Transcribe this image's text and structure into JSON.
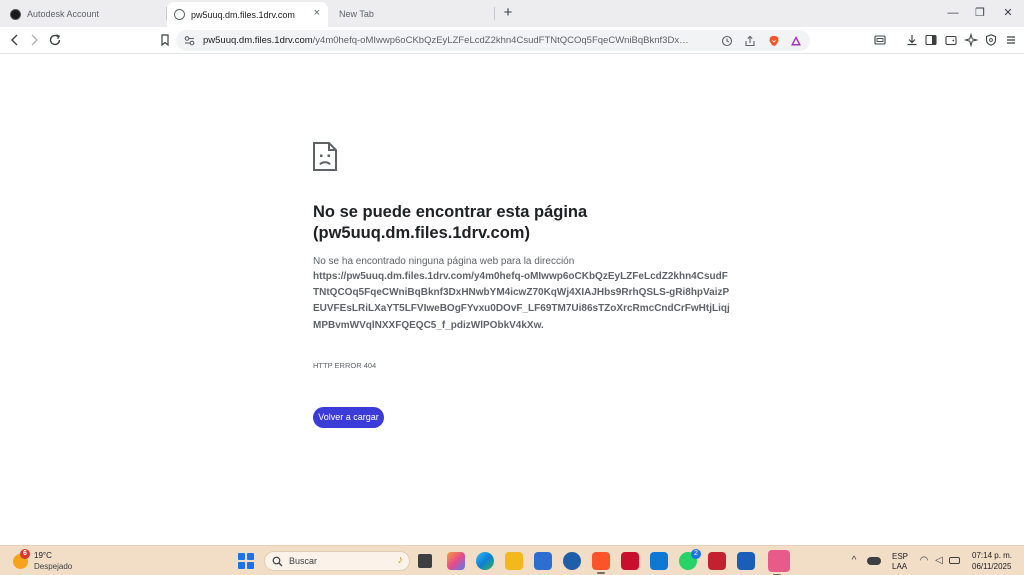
{
  "tabs": [
    {
      "title": "Autodesk Account",
      "active": false
    },
    {
      "title": "pw5uuq.dm.files.1drv.com",
      "active": true
    },
    {
      "title": "New Tab",
      "active": false
    }
  ],
  "icons": {
    "close": "×",
    "new_tab": "+",
    "minimize": "—",
    "restore": "❐",
    "window_close": "✕",
    "sad_page": "sad-page-icon"
  },
  "address_bar": {
    "host": "pw5uuq.dm.files.1drv.com",
    "path": "/y4m0hefq-oMIwwp6oCKbQzEyLZFeLcdZ2khn4CsudFTNtQCOq5FqeCWniBqBknf3DxHNwbYM4..."
  },
  "error_page": {
    "title": "No se puede encontrar esta página (pw5uuq.dm.files.1drv.com)",
    "description": "No se ha encontrado ninguna página web para la dirección",
    "url": "https://pw5uuq.dm.files.1drv.com/y4m0hefq-oMIwwp6oCKbQzEyLZFeLcdZ2khn4CsudFTNtQCOq5FqeCWniBqBknf3DxHNwbYM4icwZ70KqWj4XIAJHbs9RrhQSLS-gRi8hpVaizPEUVFEsLRiLXaYT5LFVIweBOgFYvxu0DOvF_LF69TM7Ui86sTZoXrcRmcCndCrFwHtjLiqjMPBvmWVqlNXXFQEQC5_f_pdizWlPObkV4kXw.",
    "code": "HTTP ERROR 404",
    "reload_label": "Volver a cargar"
  },
  "taskbar": {
    "weather_badge": "6",
    "temperature": "19°C",
    "condition": "Despejado",
    "search_label": "Buscar",
    "whatsapp_badge": "2",
    "language": "ESP",
    "layout": "LAA",
    "time": "07:14 p. m.",
    "date": "06/11/2025"
  },
  "colors": {
    "tab_strip": "#ededf0",
    "reload_button": "#3b3bd8",
    "taskbar": "#f2ddc6"
  }
}
